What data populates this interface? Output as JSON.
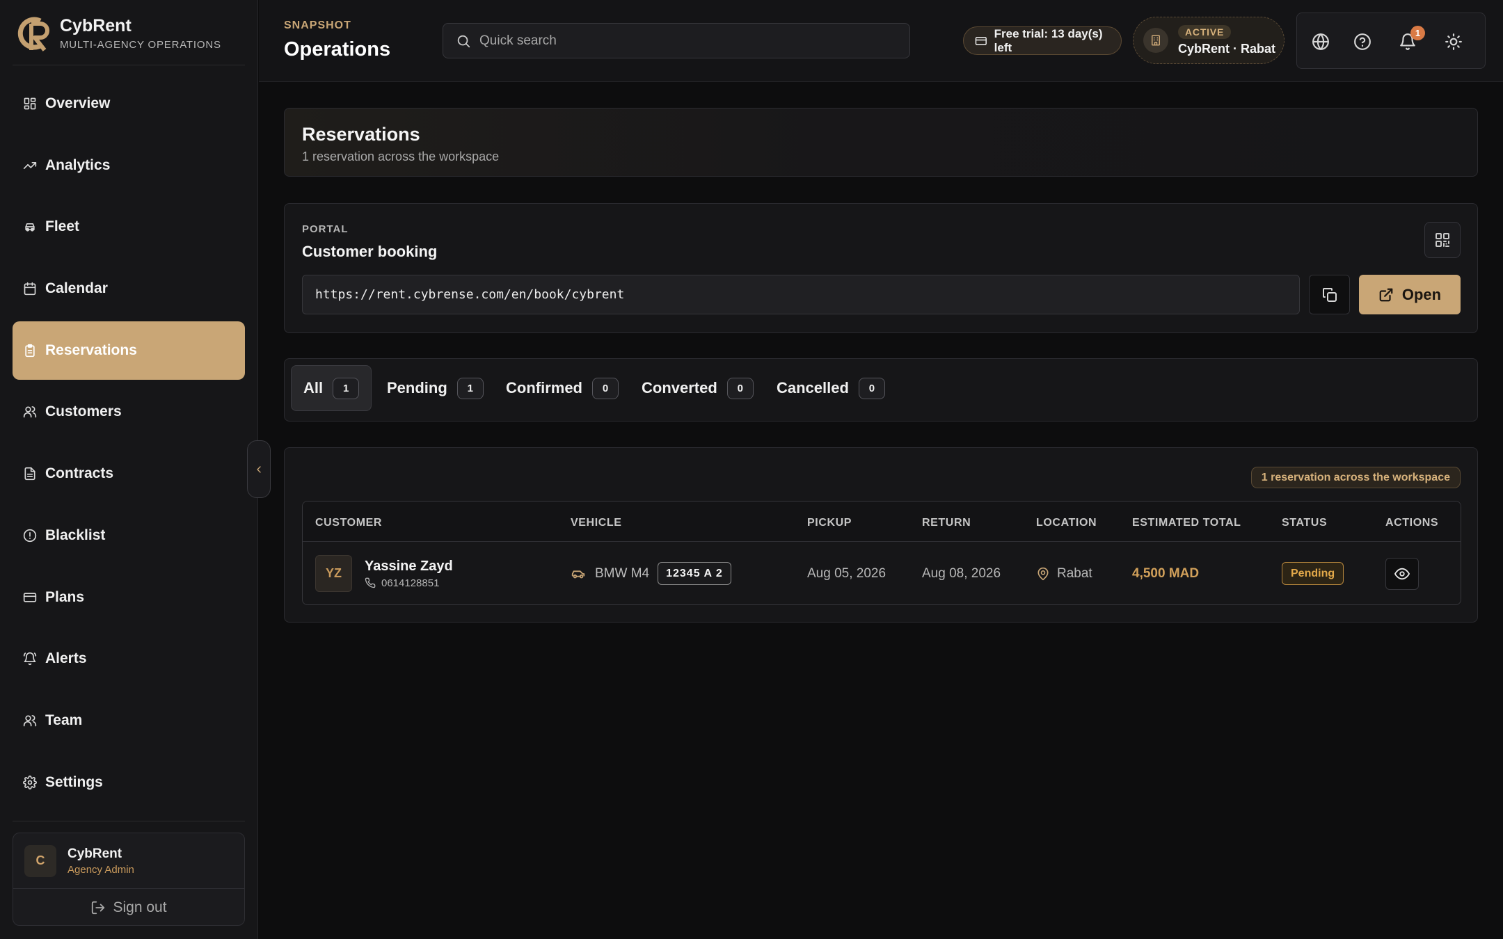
{
  "brand": {
    "name": "CybRent",
    "subtitle": "MULTI-AGENCY OPERATIONS"
  },
  "sidebar": {
    "items": [
      {
        "label": "Overview",
        "icon": "grid-icon"
      },
      {
        "label": "Analytics",
        "icon": "trend-icon"
      },
      {
        "label": "Fleet",
        "icon": "car-icon"
      },
      {
        "label": "Calendar",
        "icon": "calendar-icon"
      },
      {
        "label": "Reservations",
        "icon": "clipboard-icon",
        "active": true
      },
      {
        "label": "Customers",
        "icon": "users-icon"
      },
      {
        "label": "Contracts",
        "icon": "file-icon"
      },
      {
        "label": "Blacklist",
        "icon": "alert-circle-icon"
      },
      {
        "label": "Plans",
        "icon": "credit-card-icon"
      },
      {
        "label": "Alerts",
        "icon": "bell-icon"
      },
      {
        "label": "Team",
        "icon": "team-icon"
      },
      {
        "label": "Settings",
        "icon": "gear-icon"
      }
    ],
    "user": {
      "initial": "C",
      "name": "CybRent",
      "role": "Agency Admin"
    },
    "signout_label": "Sign out"
  },
  "header": {
    "eyebrow": "SNAPSHOT",
    "title": "Operations",
    "search_placeholder": "Quick search",
    "trial_label": "Free trial: 13 day(s) left",
    "agency_status": "ACTIVE",
    "agency_name": "CybRent · Rabat",
    "notification_count": "1"
  },
  "reservations_header": {
    "title": "Reservations",
    "subtitle": "1 reservation across the workspace"
  },
  "portal": {
    "eyebrow": "PORTAL",
    "title": "Customer booking",
    "url": "https://rent.cybrense.com/en/book/cybrent",
    "open_label": "Open"
  },
  "tabs": [
    {
      "label": "All",
      "count": "1"
    },
    {
      "label": "Pending",
      "count": "1"
    },
    {
      "label": "Confirmed",
      "count": "0"
    },
    {
      "label": "Converted",
      "count": "0"
    },
    {
      "label": "Cancelled",
      "count": "0"
    }
  ],
  "table": {
    "count_label": "1 reservation across the workspace",
    "columns": [
      "CUSTOMER",
      "VEHICLE",
      "PICKUP",
      "RETURN",
      "LOCATION",
      "ESTIMATED TOTAL",
      "STATUS",
      "ACTIONS"
    ],
    "rows": [
      {
        "initials": "YZ",
        "customer": "Yassine Zayd",
        "phone": "0614128851",
        "vehicle": "BMW M4",
        "plate": "12345 A 2",
        "pickup": "Aug 05, 2026",
        "return": "Aug 08, 2026",
        "location": "Rabat",
        "total": "4,500 MAD",
        "status": "Pending"
      }
    ]
  },
  "colors": {
    "accent": "#c9a676",
    "background": "#0d0d0e",
    "status_pending": "#e3a94a"
  }
}
